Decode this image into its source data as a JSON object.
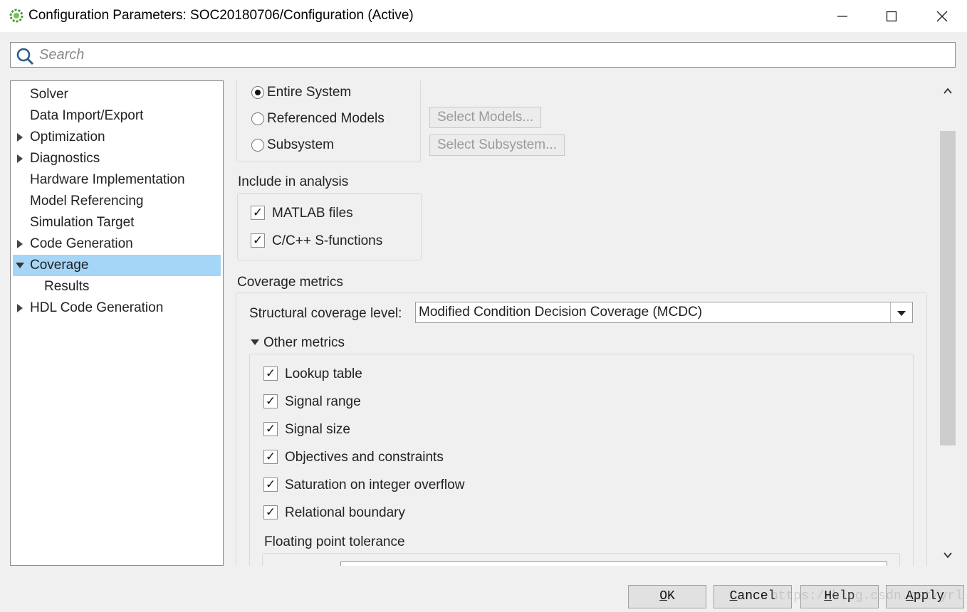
{
  "window": {
    "title": "Configuration Parameters: SOC20180706/Configuration (Active)",
    "icon": "gear-icon",
    "controls": [
      "minimize-icon",
      "maximize-icon",
      "close-icon"
    ]
  },
  "search": {
    "placeholder": "Search"
  },
  "tree": {
    "items": [
      {
        "label": "Solver",
        "expander": "none",
        "selected": false
      },
      {
        "label": "Data Import/Export",
        "expander": "none",
        "selected": false
      },
      {
        "label": "Optimization",
        "expander": "collapsed",
        "selected": false
      },
      {
        "label": "Diagnostics",
        "expander": "collapsed",
        "selected": false
      },
      {
        "label": "Hardware Implementation",
        "expander": "none",
        "selected": false
      },
      {
        "label": "Model Referencing",
        "expander": "none",
        "selected": false
      },
      {
        "label": "Simulation Target",
        "expander": "none",
        "selected": false
      },
      {
        "label": "Code Generation",
        "expander": "collapsed",
        "selected": false
      },
      {
        "label": "Coverage",
        "expander": "expanded",
        "selected": true
      },
      {
        "label": "Results",
        "expander": "none",
        "selected": false
      },
      {
        "label": "HDL Code Generation",
        "expander": "collapsed",
        "selected": false
      }
    ]
  },
  "scope": {
    "options": [
      {
        "label": "Entire System",
        "selected": true
      },
      {
        "label": "Referenced Models",
        "selected": false
      },
      {
        "label": "Subsystem",
        "selected": false
      }
    ],
    "select_models_label": "Select Models...",
    "select_subsystem_label": "Select Subsystem..."
  },
  "include": {
    "heading": "Include in analysis",
    "items": [
      {
        "label": "MATLAB files",
        "checked": true
      },
      {
        "label": "C/C++ S-functions",
        "checked": true
      }
    ]
  },
  "metrics": {
    "heading": "Coverage metrics",
    "structural_label": "Structural coverage level:",
    "structural_value": "Modified Condition Decision Coverage (MCDC)",
    "other_heading": "Other metrics",
    "other_items": [
      {
        "label": "Lookup table",
        "checked": true
      },
      {
        "label": "Signal range",
        "checked": true
      },
      {
        "label": "Signal size",
        "checked": true
      },
      {
        "label": "Objectives and constraints",
        "checked": true
      },
      {
        "label": "Saturation on integer overflow",
        "checked": true
      },
      {
        "label": "Relational boundary",
        "checked": true
      }
    ],
    "tolerance_heading": "Floating point tolerance"
  },
  "buttons": {
    "ok": {
      "hotkey": "O",
      "rest": "K"
    },
    "cancel": {
      "hotkey": "C",
      "rest": "ancel"
    },
    "help": {
      "hotkey": "H",
      "rest": "elp"
    },
    "apply": {
      "hotkey": "A",
      "rest": "pply"
    }
  },
  "watermark": "https://blog.csdn.net/yrl"
}
